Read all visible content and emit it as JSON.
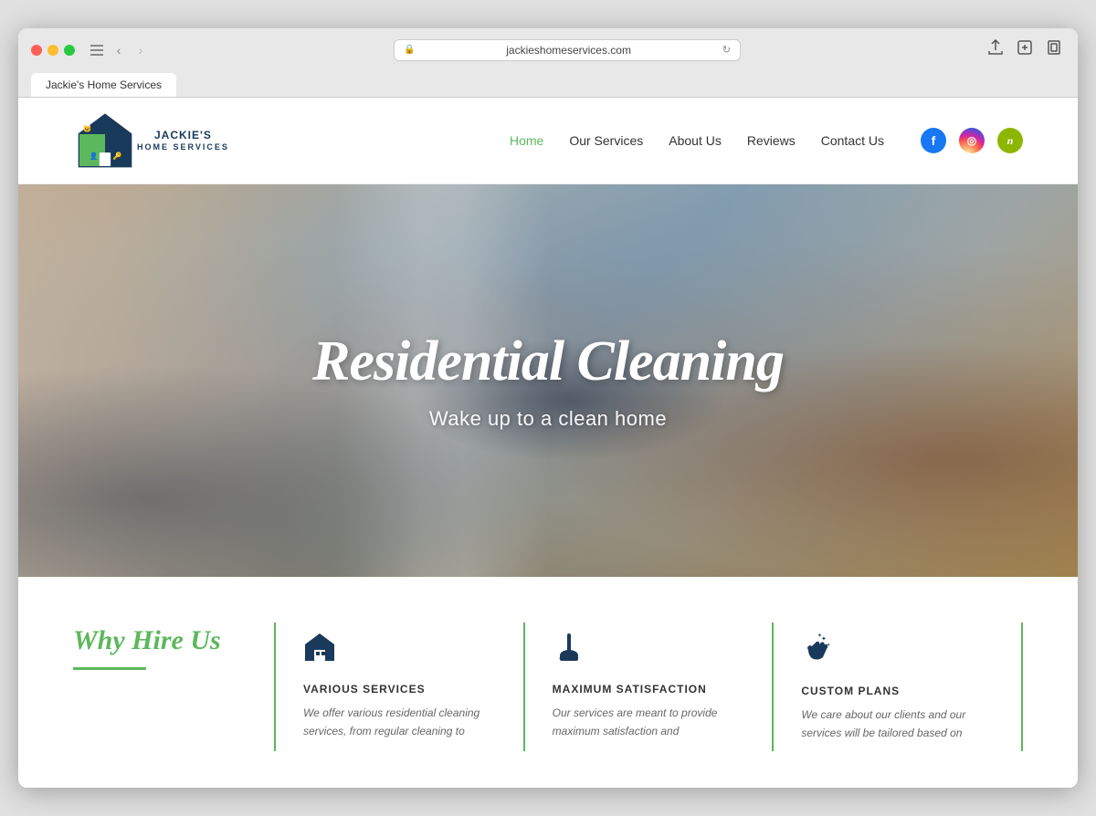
{
  "browser": {
    "url": "jackieshomeservices.com",
    "tab_label": "Jackie's Home Services"
  },
  "header": {
    "logo_name": "JACKIE'S",
    "logo_sub": "HOME SERVICES",
    "nav": [
      {
        "label": "Home",
        "active": true
      },
      {
        "label": "Our Services",
        "active": false
      },
      {
        "label": "About Us",
        "active": false
      },
      {
        "label": "Reviews",
        "active": false
      },
      {
        "label": "Contact Us",
        "active": false
      }
    ],
    "social": [
      {
        "label": "f",
        "name": "facebook"
      },
      {
        "label": "📷",
        "name": "instagram"
      },
      {
        "label": "n",
        "name": "nextdoor"
      }
    ]
  },
  "hero": {
    "title": "Residential Cleaning",
    "subtitle": "Wake up to a clean home"
  },
  "why_section": {
    "heading_line1": "Why Hire Us",
    "services": [
      {
        "icon": "🏠",
        "title": "VARIOUS SERVICES",
        "description": "We offer various residential cleaning services, from regular cleaning to"
      },
      {
        "icon": "🧹",
        "title": "MAXIMUM SATISFACTION",
        "description": "Our services are meant to provide maximum satisfaction and"
      },
      {
        "icon": "✋",
        "title": "CUSTOM PLANS",
        "description": "We care about our clients and our services will be tailored based on"
      }
    ]
  }
}
